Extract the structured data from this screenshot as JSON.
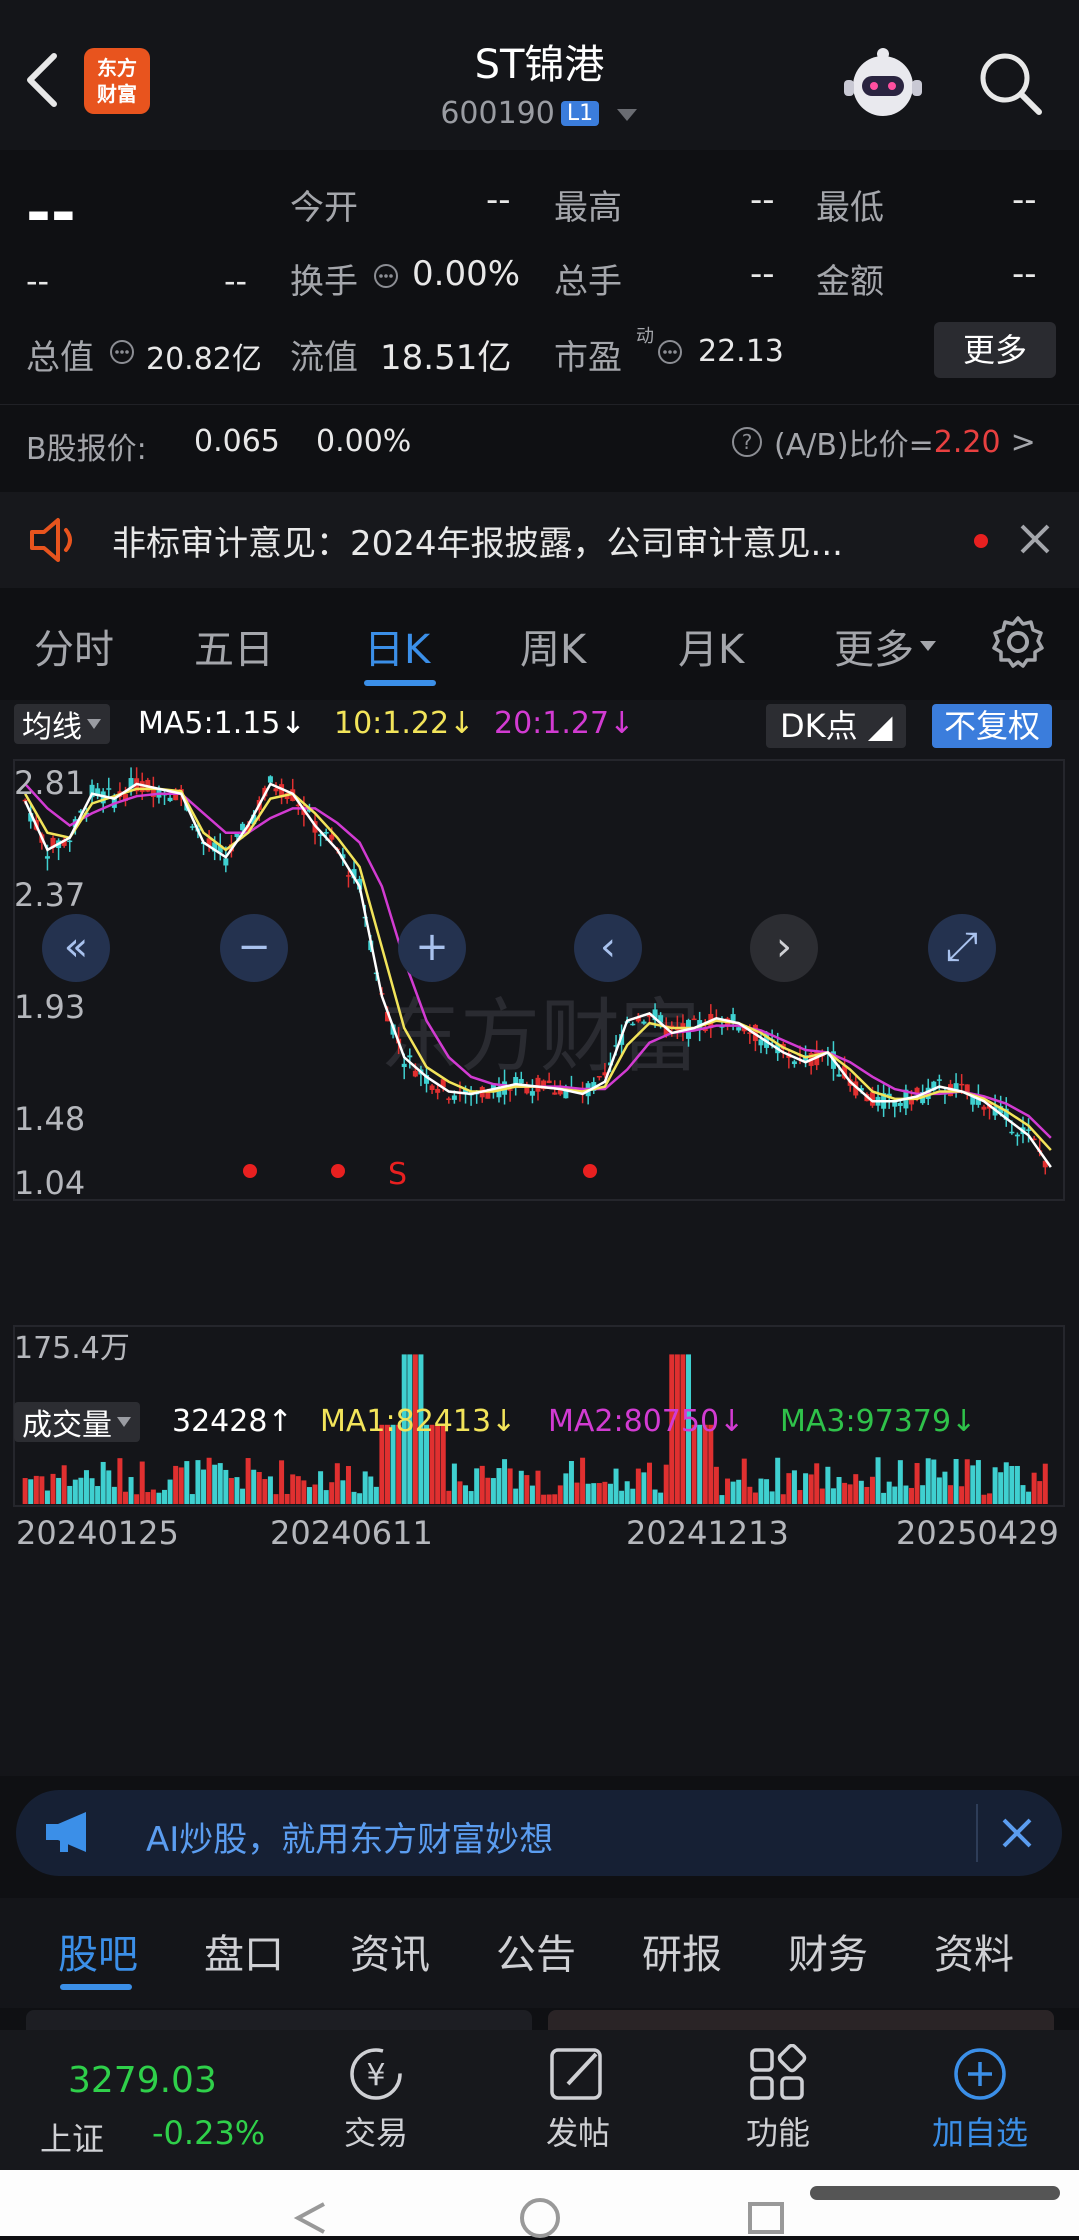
{
  "header": {
    "logo_text_line1": "东方",
    "logo_text_line2": "财富",
    "title": "ST锦港",
    "code": "600190",
    "level_badge": "L1"
  },
  "quote": {
    "price": "--",
    "change": "--",
    "change_pct": "--",
    "open_label": "今开",
    "open_value": "--",
    "high_label": "最高",
    "high_value": "--",
    "low_label": "最低",
    "low_value": "--",
    "turnover_label": "换手",
    "turnover_value": "0.00%",
    "volume_label": "总手",
    "volume_value": "--",
    "amount_label": "金额",
    "amount_value": "--",
    "mktcap_label": "总值",
    "mktcap_value": "20.82亿",
    "float_label": "流值",
    "float_value": "18.51亿",
    "pe_label": "市盈",
    "pe_sup": "动",
    "pe_value": "22.13",
    "more_button": "更多",
    "bshare_label": "B股报价:",
    "bshare_price": "0.065",
    "bshare_pct": "0.00%",
    "ab_ratio_label": "(A/B)比价=",
    "ab_ratio_value": "2.20",
    "ab_arrow": ">"
  },
  "notice": {
    "text": "非标审计意见：2024年报披露，公司审计意见..."
  },
  "kline_tabs": [
    "分时",
    "五日",
    "日K",
    "周K",
    "月K",
    "更多"
  ],
  "active_tab_index": 2,
  "chart": {
    "ma_selector": "均线",
    "ma5": "MA5:1.15",
    "ma10": "10:1.22",
    "ma20": "20:1.27",
    "dk_button": "DK点",
    "fuquan_button": "不复权",
    "y_ticks": [
      "2.81",
      "2.37",
      "1.93",
      "1.48",
      "1.04"
    ],
    "signal_s": "S",
    "watermark": "东方财富",
    "vol_selector": "成交量",
    "vol_value": "32428",
    "vma1": "MA1:82413",
    "vma2": "MA2:80750",
    "vma3": "MA3:97379",
    "vol_max": "175.4万",
    "x_ticks": [
      "20240125",
      "20240611",
      "20241213",
      "20250429"
    ]
  },
  "chart_data": {
    "type": "candlestick",
    "price_axis": [
      1.04,
      2.81
    ],
    "ma_lines": {
      "MA5": [
        2.65,
        2.45,
        2.5,
        2.68,
        2.66,
        2.72,
        2.7,
        2.68,
        2.48,
        2.42,
        2.55,
        2.72,
        2.68,
        2.55,
        2.45,
        2.3,
        1.85,
        1.6,
        1.52,
        1.46,
        1.45,
        1.47,
        1.49,
        1.48,
        1.47,
        1.45,
        1.5,
        1.75,
        1.78,
        1.7,
        1.72,
        1.76,
        1.74,
        1.68,
        1.62,
        1.58,
        1.62,
        1.5,
        1.42,
        1.42,
        1.44,
        1.48,
        1.46,
        1.42,
        1.35,
        1.28,
        1.15
      ],
      "MA10": [
        2.68,
        2.52,
        2.5,
        2.64,
        2.67,
        2.7,
        2.7,
        2.69,
        2.52,
        2.45,
        2.52,
        2.66,
        2.68,
        2.6,
        2.5,
        2.38,
        2.05,
        1.72,
        1.56,
        1.5,
        1.46,
        1.46,
        1.48,
        1.48,
        1.47,
        1.46,
        1.48,
        1.65,
        1.74,
        1.72,
        1.72,
        1.75,
        1.74,
        1.7,
        1.64,
        1.6,
        1.62,
        1.55,
        1.46,
        1.43,
        1.43,
        1.46,
        1.46,
        1.43,
        1.38,
        1.32,
        1.22
      ],
      "MA20": [
        2.72,
        2.62,
        2.55,
        2.6,
        2.64,
        2.67,
        2.68,
        2.68,
        2.6,
        2.52,
        2.52,
        2.58,
        2.62,
        2.62,
        2.56,
        2.48,
        2.3,
        2.0,
        1.75,
        1.6,
        1.52,
        1.49,
        1.48,
        1.48,
        1.48,
        1.47,
        1.47,
        1.55,
        1.66,
        1.7,
        1.71,
        1.73,
        1.73,
        1.71,
        1.67,
        1.63,
        1.62,
        1.58,
        1.52,
        1.47,
        1.45,
        1.45,
        1.46,
        1.44,
        1.41,
        1.36,
        1.27
      ]
    },
    "volume_axis_max": 1754000,
    "x_labels": [
      "20240125",
      "20240611",
      "20241213",
      "20250429"
    ]
  },
  "ai_bar": {
    "text": "AI炒股，就用东方财富妙想"
  },
  "info_tabs": [
    "股吧",
    "盘口",
    "资讯",
    "公告",
    "研报",
    "财务",
    "资料"
  ],
  "bottom_bar": {
    "index_value": "3279.03",
    "index_name": "上证",
    "index_change": "-0.23%",
    "trade": "交易",
    "post": "发帖",
    "func": "功能",
    "add": "加自选"
  },
  "colors": {
    "up": "#e03030",
    "down": "#3fd0d0",
    "ma5": "#ffffff",
    "ma10": "#f2e45a",
    "ma20": "#d23bd2",
    "accent": "#3b7ddc"
  }
}
